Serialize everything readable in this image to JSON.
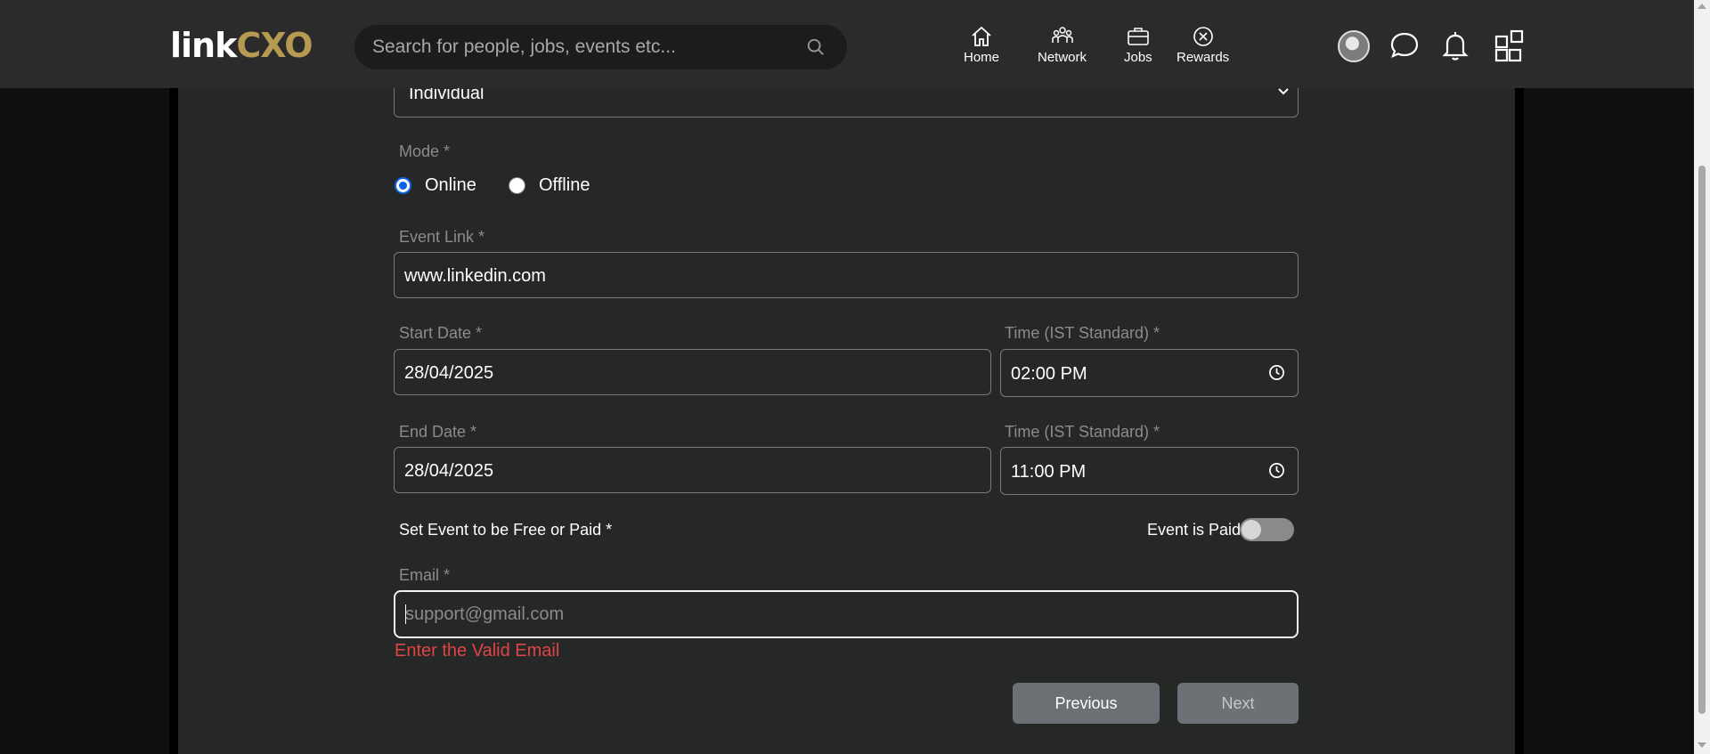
{
  "header": {
    "logo": {
      "part1": "link",
      "part2": "CXO"
    },
    "search": {
      "placeholder": "Search for people, jobs, events etc..."
    },
    "nav": [
      {
        "label": "Home",
        "icon": "home-icon"
      },
      {
        "label": "Network",
        "icon": "network-icon"
      },
      {
        "label": "Jobs",
        "icon": "briefcase-icon"
      },
      {
        "label": "Rewards",
        "icon": "rewards-icon"
      }
    ],
    "right_icons": [
      "avatar",
      "chat-icon",
      "bell-icon",
      "apps-grid-icon"
    ]
  },
  "form": {
    "organizer_type": {
      "selected": "Individual"
    },
    "mode": {
      "label": "Mode *",
      "options": [
        {
          "label": "Online",
          "selected": true
        },
        {
          "label": "Offline",
          "selected": false
        }
      ]
    },
    "event_link": {
      "label": "Event Link *",
      "value": "www.linkedin.com"
    },
    "start_date": {
      "label": "Start Date *",
      "value": "28/04/2025"
    },
    "start_time": {
      "label": "Time (IST Standard) *",
      "value": "02:00 PM"
    },
    "end_date": {
      "label": "End Date *",
      "value": "28/04/2025"
    },
    "end_time": {
      "label": "Time (IST Standard) *",
      "value": "11:00 PM"
    },
    "pricing": {
      "label": "Set Event to be Free or Paid *",
      "toggle_label": "Event is Paid",
      "paid": false
    },
    "email": {
      "label": "Email *",
      "value": "",
      "placeholder": "support@gmail.com",
      "error": "Enter the Valid Email"
    },
    "buttons": {
      "previous": "Previous",
      "next": "Next"
    }
  },
  "colors": {
    "accent_gold": "#b79a52",
    "header_bg": "#2b2b2b",
    "panel_bg": "#262727",
    "error": "#e04444",
    "radio_selected": "#0b63e5",
    "button_bg": "#6b7075"
  }
}
